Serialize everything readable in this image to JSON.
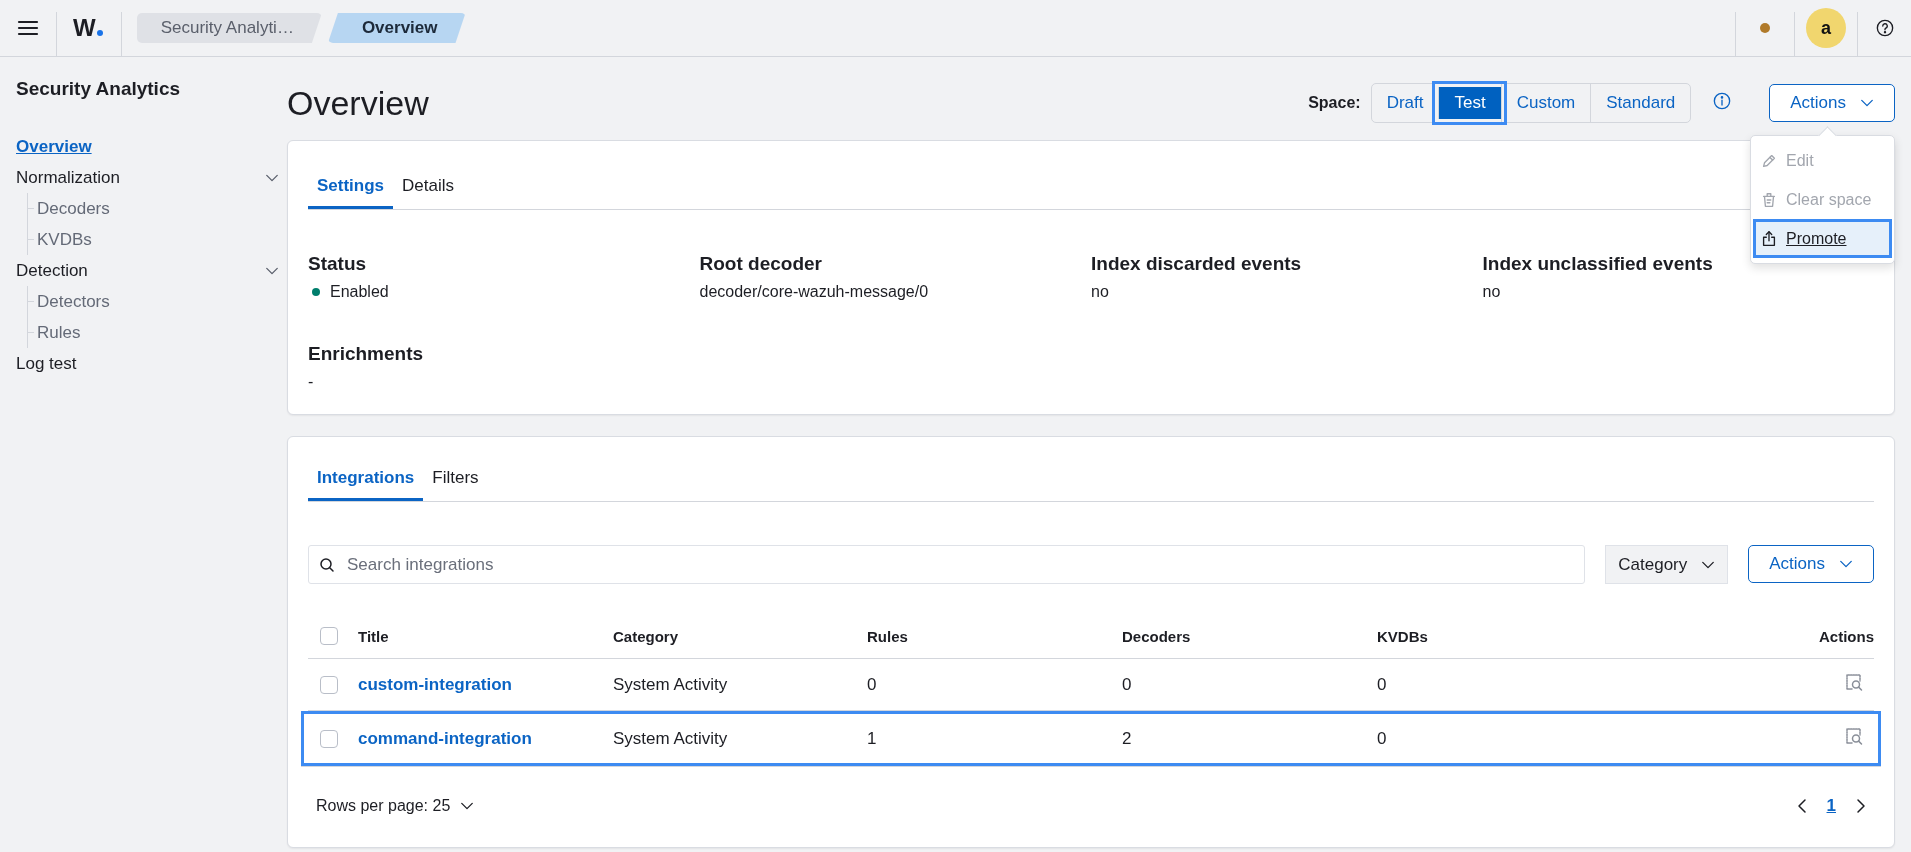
{
  "top_bar": {
    "logo": "W",
    "breadcrumbs": [
      {
        "label": "Security Analyti…",
        "selected": false
      },
      {
        "label": "Overview",
        "selected": true
      }
    ],
    "avatar": "a"
  },
  "sidebar": {
    "title": "Security Analytics",
    "items": [
      {
        "kind": "link",
        "label": "Overview",
        "selected": true
      },
      {
        "kind": "group",
        "label": "Normalization",
        "selected": false,
        "expanded": true,
        "children": [
          {
            "label": "Decoders",
            "selected": false
          },
          {
            "label": "KVDBs",
            "selected": false
          }
        ]
      },
      {
        "kind": "group",
        "label": "Detection",
        "selected": false,
        "expanded": true,
        "children": [
          {
            "label": "Detectors",
            "selected": false
          },
          {
            "label": "Rules",
            "selected": false
          }
        ]
      },
      {
        "kind": "link",
        "label": "Log test",
        "selected": false
      }
    ]
  },
  "header": {
    "title": "Overview",
    "space_label": "Space:",
    "space_options": [
      {
        "label": "Draft",
        "selected": false,
        "highlighted": false
      },
      {
        "label": "Test",
        "selected": true,
        "highlighted": true
      },
      {
        "label": "Custom",
        "selected": false,
        "highlighted": false
      },
      {
        "label": "Standard",
        "selected": false,
        "highlighted": false
      }
    ],
    "actions_button": "Actions"
  },
  "actions_menu": {
    "items": [
      {
        "kind": "edit",
        "label": "Edit",
        "disabled": true,
        "highlighted": false
      },
      {
        "kind": "clear",
        "label": "Clear space",
        "disabled": true,
        "highlighted": false
      },
      {
        "kind": "promote",
        "label": "Promote",
        "disabled": false,
        "highlighted": true
      }
    ]
  },
  "settings_card": {
    "tabs": [
      {
        "label": "Settings",
        "selected": true
      },
      {
        "label": "Details",
        "selected": false
      }
    ],
    "fields": [
      {
        "kind": "status",
        "label": "Status",
        "value": "Enabled"
      },
      {
        "kind": "text",
        "label": "Root decoder",
        "value": "decoder/core-wazuh-message/0"
      },
      {
        "kind": "text",
        "label": "Index discarded events",
        "value": "no"
      },
      {
        "kind": "text",
        "label": "Index unclassified events",
        "value": "no"
      },
      {
        "kind": "text",
        "label": "Enrichments",
        "value": "-"
      }
    ]
  },
  "integrations_card": {
    "tabs": [
      {
        "label": "Integrations",
        "selected": true
      },
      {
        "label": "Filters",
        "selected": false
      }
    ],
    "search": {
      "placeholder": "Search integrations"
    },
    "category_filter": "Category",
    "actions_button": "Actions",
    "table": {
      "select_all_checked": false,
      "columns": [
        "Title",
        "Category",
        "Rules",
        "Decoders",
        "KVDBs",
        "Actions"
      ],
      "rows": [
        {
          "cells": [
            "custom-integration",
            "System Activity",
            "0",
            "0",
            "0"
          ],
          "checked": false,
          "highlighted": false
        },
        {
          "cells": [
            "command-integration",
            "System Activity",
            "1",
            "2",
            "0"
          ],
          "checked": false,
          "highlighted": true
        }
      ]
    },
    "rows_per_page": "Rows per page: 25",
    "pages": [
      {
        "label": "1",
        "selected": true
      }
    ]
  }
}
